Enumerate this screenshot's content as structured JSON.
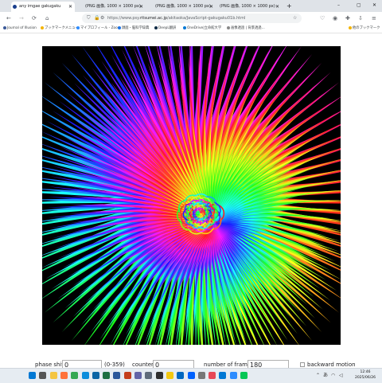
{
  "browser": {
    "tabs": [
      {
        "title": "any imgae gakugaku",
        "active": true
      },
      {
        "title": "(PNG 画像, 1000 × 1000 px)",
        "active": false
      },
      {
        "title": "(PNG 画像, 1000 × 1000 px)",
        "active": false
      },
      {
        "title": "(PNG 画像, 1000 × 1000 px)",
        "active": false
      }
    ],
    "new_tab": "+",
    "window_controls": {
      "minimize": "–",
      "maximize": "▢",
      "close": "✕"
    },
    "nav": {
      "back": "←",
      "forward": "→",
      "reload": "⟳",
      "home": "⌂"
    },
    "url_prefix": "https://www.psy.",
    "url_domain": "ritsumei.ac.jp",
    "url_path": "/akitaoka/JavaScript-gakugaku01b.html",
    "bookmarks": [
      {
        "label": "Journal of Illusion",
        "color": "#3b5998"
      },
      {
        "label": "ブックマークメニュー",
        "color": "#f4b400"
      },
      {
        "label": "マイプロフィール - Zoom",
        "color": "#2d8cff"
      },
      {
        "label": "顔面・脳科学辞典",
        "color": "#1a73e8"
      },
      {
        "label": "DeepL翻訳",
        "color": "#0f2b46"
      },
      {
        "label": "OneDrive|立命館大学",
        "color": "#0078d4"
      },
      {
        "label": "画像透過 | 背景透過…",
        "color": "#888888"
      }
    ],
    "other_bookmarks": "他のブックマーク"
  },
  "controls": {
    "phase_shift_label": "phase shift",
    "phase_shift_value": "0",
    "phase_range": "(0-359)",
    "counter_label": "counter:",
    "counter_value": "0",
    "frames_label": "number of frames:",
    "frames_value": "180",
    "backward_label": "backward motion"
  },
  "taskbar": {
    "time": "12:46",
    "date": "2025/06/26",
    "apps": [
      "start",
      "search",
      "explorer",
      "firefox",
      "chrome",
      "edge",
      "mail",
      "excel",
      "word",
      "powerpoint",
      "teams",
      "store",
      "terminal",
      "notes",
      "photos",
      "dropbox",
      "settings",
      "paint",
      "calendar",
      "zoom",
      "line"
    ],
    "app_colors": [
      "#0078d4",
      "#555",
      "#f4c542",
      "#ff7139",
      "#34a853",
      "#0c8ddc",
      "#0a64a4",
      "#1d6f42",
      "#2b579a",
      "#c43e1c",
      "#6264a7",
      "#5f6b7a",
      "#2e2e2e",
      "#f2c811",
      "#0067c0",
      "#0061fe",
      "#777",
      "#e74856",
      "#0078d4",
      "#2d8cff",
      "#06c755"
    ]
  },
  "colors": {
    "tabstrip": "#dfe3e8",
    "canvas_bg": "#000000",
    "taskbar": "#e6ecf2"
  }
}
